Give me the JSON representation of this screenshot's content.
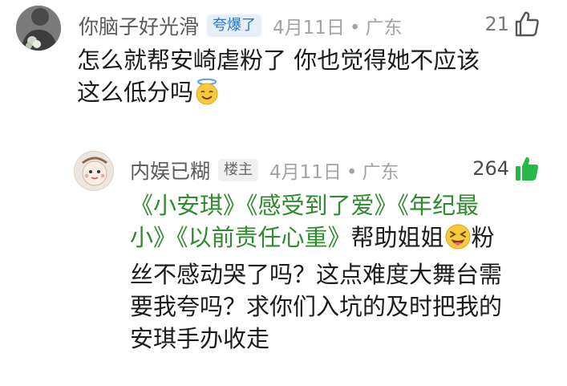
{
  "comments": [
    {
      "username": "你脑子好光滑",
      "badge": "夸爆了",
      "date": "4月11日",
      "location": "广东",
      "likes": "21",
      "text_line1": "怎么就帮安崎虐粉了 你也觉得她不应该",
      "text_line2": "这么低分吗"
    },
    {
      "username": "内娱已糊",
      "badge": "楼主",
      "date": "4月11日",
      "location": "广东",
      "likes": "264",
      "tags_line1": [
        "《小安琪》",
        "《感受到了爱》",
        "《年纪最"
      ],
      "tags_line2": [
        "小》",
        "《以前责任心重》"
      ],
      "text_after_tags": "帮助姐姐",
      "text_tail": "粉",
      "text_line3": "丝不感动哭了吗？这点难度大舞台需",
      "text_line4": "要我夸吗？求你们入坑的及时把我的",
      "text_line5": "安琪手办收走"
    }
  ],
  "colors": {
    "link": "#2e8b2e",
    "badge_hot": "#2f73c9",
    "thumb_active": "#27b84a"
  }
}
